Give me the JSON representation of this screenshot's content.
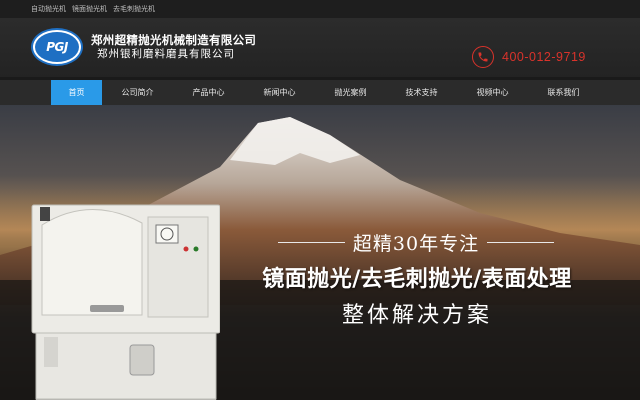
{
  "topbar": {
    "links": [
      "自动抛光机",
      "镜面抛光机",
      "去毛刺抛光机"
    ]
  },
  "header": {
    "logo_text": "PGJ",
    "company_name": "郑州超精抛光机械制造有限公司",
    "company_sub": "郑州银利磨料磨具有限公司",
    "hotline": "400-012-9719",
    "phone_icon": "phone-icon",
    "accent_color": "#d9332b"
  },
  "nav": {
    "items": [
      "首页",
      "公司简介",
      "产品中心",
      "新闻中心",
      "抛光案例",
      "技术支持",
      "视频中心",
      "联系我们"
    ],
    "active_index": 0,
    "active_color": "#2a9ae8"
  },
  "banner": {
    "tagline1": "超精30年专注",
    "tagline2": "镜面抛光/去毛刺抛光/表面处理",
    "tagline3": "整体解决方案"
  }
}
